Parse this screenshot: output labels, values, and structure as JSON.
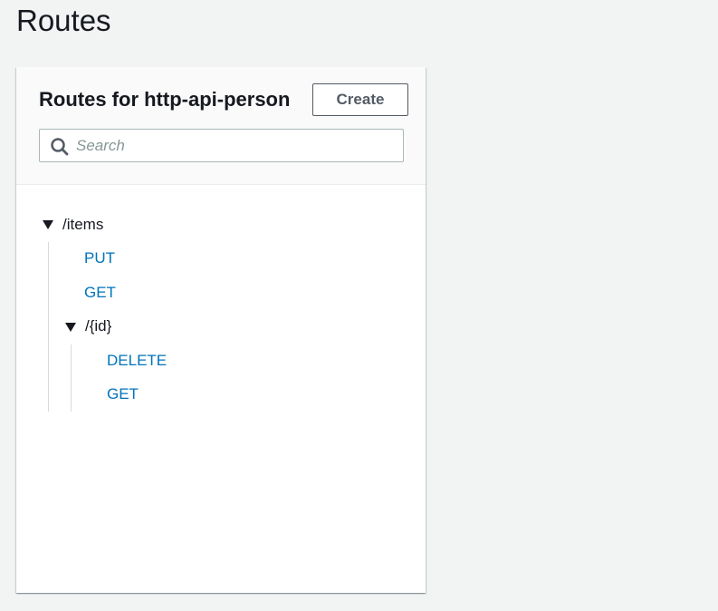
{
  "page": {
    "title": "Routes"
  },
  "panel": {
    "title": "Routes for http-api-person",
    "create_label": "Create",
    "search_placeholder": "Search"
  },
  "tree": {
    "root": {
      "path": "/items",
      "expanded": true,
      "methods": [
        "PUT",
        "GET"
      ],
      "child": {
        "path": "/{id}",
        "expanded": true,
        "methods": [
          "DELETE",
          "GET"
        ]
      }
    }
  },
  "colors": {
    "page_bg": "#f2f3f3",
    "link": "#0073bb",
    "text": "#16191f",
    "button_border": "#545b64"
  }
}
